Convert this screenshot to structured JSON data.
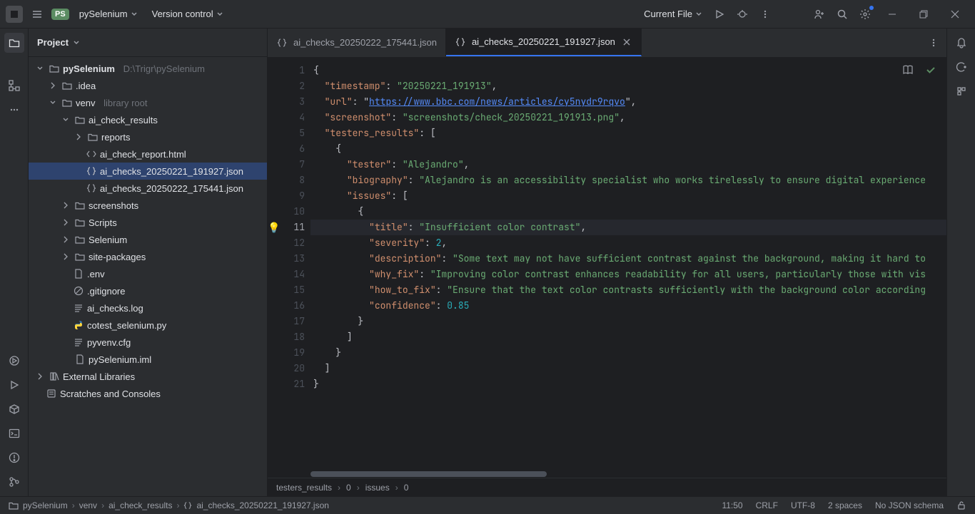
{
  "header": {
    "project_badge": "PS",
    "project_name": "pySelenium",
    "vcs": "Version control",
    "run_config": "Current File"
  },
  "sidebar": {
    "title": "Project",
    "tree": {
      "root": {
        "name": "pySelenium",
        "path": "D:\\Trigr\\pySelenium"
      },
      "idea": ".idea",
      "venv": "venv",
      "venv_hint": "library root",
      "ai_check_results": "ai_check_results",
      "reports": "reports",
      "ai_check_report_html": "ai_check_report.html",
      "ai_checks_json1": "ai_checks_20250221_191927.json",
      "ai_checks_json2": "ai_checks_20250222_175441.json",
      "screenshots": "screenshots",
      "scripts": "Scripts",
      "selenium": "Selenium",
      "site_packages": "site-packages",
      "env": ".env",
      "gitignore": ".gitignore",
      "ai_checks_log": "ai_checks.log",
      "cotest": "cotest_selenium.py",
      "pyvenv": "pyvenv.cfg",
      "iml": "pySelenium.iml",
      "ext_lib": "External Libraries",
      "scratches": "Scratches and Consoles"
    }
  },
  "tabs": [
    {
      "label": "ai_checks_20250222_175441.json"
    },
    {
      "label": "ai_checks_20250221_191927.json"
    }
  ],
  "editor": {
    "lines": [
      {
        "n": "1",
        "indent": 0,
        "tokens": [
          [
            "punc",
            "{"
          ]
        ]
      },
      {
        "n": "2",
        "indent": 1,
        "tokens": [
          [
            "prop",
            "\"timestamp\""
          ],
          [
            "punc",
            ": "
          ],
          [
            "str",
            "\"20250221_191913\""
          ],
          [
            "punc",
            ","
          ]
        ]
      },
      {
        "n": "3",
        "indent": 1,
        "tokens": [
          [
            "prop",
            "\"url\""
          ],
          [
            "punc",
            ": "
          ],
          [
            "punc",
            "\""
          ],
          [
            "link",
            "https://www.bbc.com/news/articles/cy5nydr9rqvo"
          ],
          [
            "punc",
            "\""
          ],
          [
            "punc",
            ","
          ]
        ]
      },
      {
        "n": "4",
        "indent": 1,
        "tokens": [
          [
            "prop",
            "\"screenshot\""
          ],
          [
            "punc",
            ": "
          ],
          [
            "str",
            "\"screenshots/check_20250221_191913.png\""
          ],
          [
            "punc",
            ","
          ]
        ]
      },
      {
        "n": "5",
        "indent": 1,
        "tokens": [
          [
            "prop",
            "\"testers_results\""
          ],
          [
            "punc",
            ": ["
          ]
        ]
      },
      {
        "n": "6",
        "indent": 2,
        "tokens": [
          [
            "punc",
            "{"
          ]
        ]
      },
      {
        "n": "7",
        "indent": 3,
        "tokens": [
          [
            "prop",
            "\"tester\""
          ],
          [
            "punc",
            ": "
          ],
          [
            "str",
            "\"Alejandro\""
          ],
          [
            "punc",
            ","
          ]
        ]
      },
      {
        "n": "8",
        "indent": 3,
        "tokens": [
          [
            "prop",
            "\"biography\""
          ],
          [
            "punc",
            ": "
          ],
          [
            "str",
            "\"Alejandro is an accessibility specialist who works tirelessly to ensure digital experience"
          ]
        ]
      },
      {
        "n": "9",
        "indent": 3,
        "tokens": [
          [
            "prop",
            "\"issues\""
          ],
          [
            "punc",
            ": ["
          ]
        ]
      },
      {
        "n": "10",
        "indent": 4,
        "tokens": [
          [
            "punc",
            "{"
          ]
        ]
      },
      {
        "n": "11",
        "indent": 5,
        "tokens": [
          [
            "prop",
            "\"title\""
          ],
          [
            "punc",
            ": "
          ],
          [
            "str",
            "\"Insufficient color contrast\""
          ],
          [
            "punc",
            ","
          ]
        ],
        "current": true,
        "bulb": true
      },
      {
        "n": "12",
        "indent": 5,
        "tokens": [
          [
            "prop",
            "\"severity\""
          ],
          [
            "punc",
            ": "
          ],
          [
            "num",
            "2"
          ],
          [
            "punc",
            ","
          ]
        ]
      },
      {
        "n": "13",
        "indent": 5,
        "tokens": [
          [
            "prop",
            "\"description\""
          ],
          [
            "punc",
            ": "
          ],
          [
            "str",
            "\"Some text may not have sufficient contrast against the background, making it hard to"
          ]
        ]
      },
      {
        "n": "14",
        "indent": 5,
        "tokens": [
          [
            "prop",
            "\"why_fix\""
          ],
          [
            "punc",
            ": "
          ],
          [
            "str",
            "\"Improving color contrast enhances readability for all users, particularly those with vis"
          ]
        ]
      },
      {
        "n": "15",
        "indent": 5,
        "tokens": [
          [
            "prop",
            "\"how_to_fix\""
          ],
          [
            "punc",
            ": "
          ],
          [
            "str",
            "\"Ensure that the text color contrasts sufficiently with the background color according"
          ]
        ]
      },
      {
        "n": "16",
        "indent": 5,
        "tokens": [
          [
            "prop",
            "\"confidence\""
          ],
          [
            "punc",
            ": "
          ],
          [
            "num",
            "0.85"
          ]
        ]
      },
      {
        "n": "17",
        "indent": 4,
        "tokens": [
          [
            "punc",
            "}"
          ]
        ]
      },
      {
        "n": "18",
        "indent": 3,
        "tokens": [
          [
            "punc",
            "]"
          ]
        ]
      },
      {
        "n": "19",
        "indent": 2,
        "tokens": [
          [
            "punc",
            "}"
          ]
        ]
      },
      {
        "n": "20",
        "indent": 1,
        "tokens": [
          [
            "punc",
            "]"
          ]
        ]
      },
      {
        "n": "21",
        "indent": 0,
        "tokens": [
          [
            "punc",
            "}"
          ]
        ]
      }
    ]
  },
  "breadcrumb_editor": [
    "testers_results",
    "0",
    "issues",
    "0"
  ],
  "statusbar": {
    "crumbs": [
      "pySelenium",
      "venv",
      "ai_check_results",
      "ai_checks_20250221_191927.json"
    ],
    "cursor": "11:50",
    "eol": "CRLF",
    "encoding": "UTF-8",
    "indent": "2 spaces",
    "schema": "No JSON schema"
  }
}
